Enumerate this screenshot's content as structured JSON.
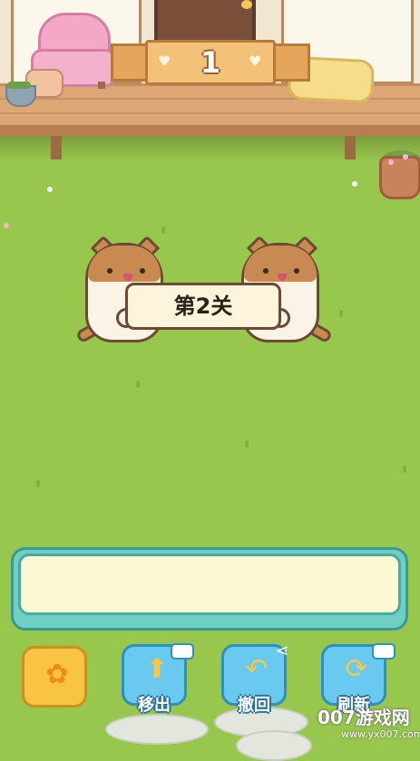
{
  "level_banner": {
    "number": "1"
  },
  "stage": {
    "label": "第2关"
  },
  "buttons": {
    "settings": {
      "icon": "flower-gear-icon"
    },
    "move_out": {
      "label": "移出",
      "icon": "box-arrow-up-icon",
      "badge": "video-icon"
    },
    "undo": {
      "label": "撤回",
      "icon": "undo-arrow-icon",
      "badge": "share-icon"
    },
    "refresh": {
      "label": "刷新",
      "icon": "refresh-icon",
      "badge": "video-icon"
    }
  },
  "watermark": {
    "main": "007游戏网",
    "sub": "www.yx007.com"
  },
  "colors": {
    "grass": "#97c74c",
    "banner": "#f3c178",
    "tray": "#6ed0c4",
    "button_blue": "#69c9ee",
    "button_yellow": "#f9c443"
  }
}
